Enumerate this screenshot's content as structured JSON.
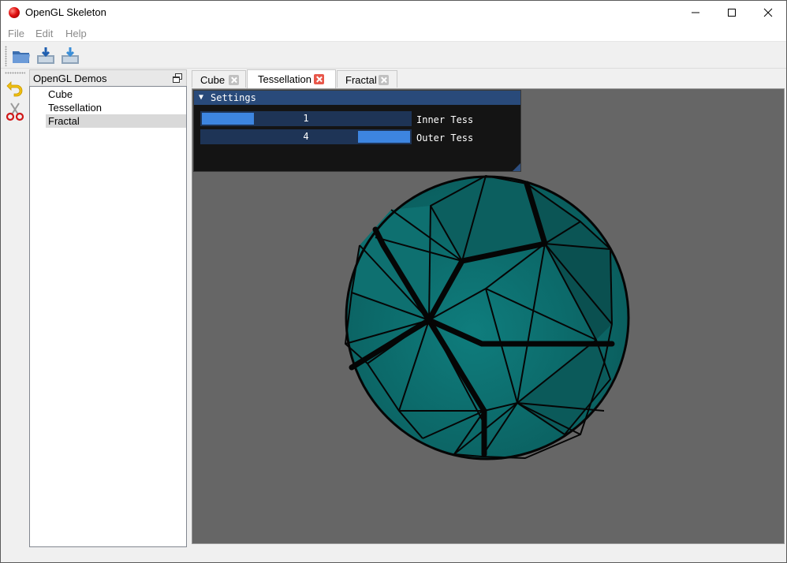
{
  "window": {
    "title": "OpenGL Skeleton"
  },
  "menu": {
    "file": "File",
    "edit": "Edit",
    "help": "Help"
  },
  "toolbar": {
    "icons": [
      "open-folder-icon",
      "save-icon",
      "save-as-icon"
    ]
  },
  "tools": {
    "icons": [
      "undo-icon",
      "scissors-icon"
    ]
  },
  "dock": {
    "title": "OpenGL Demos",
    "items": [
      {
        "label": "Cube"
      },
      {
        "label": "Tessellation"
      },
      {
        "label": "Fractal"
      }
    ],
    "selected": "Fractal"
  },
  "tabs": [
    {
      "label": "Cube"
    },
    {
      "label": "Tessellation"
    },
    {
      "label": "Fractal"
    }
  ],
  "active_tab": "Tessellation",
  "settings": {
    "title": "Settings",
    "inner": {
      "label": "Inner Tess",
      "value": "1"
    },
    "outer": {
      "label": "Outer Tess",
      "value": "4"
    }
  },
  "colors": {
    "viewport_bg": "#666666",
    "sphere_face": "#0e7272",
    "imgui_title": "#294a7a",
    "slider_grab": "#3d85e0",
    "active_tab_close": "#e8574a"
  }
}
